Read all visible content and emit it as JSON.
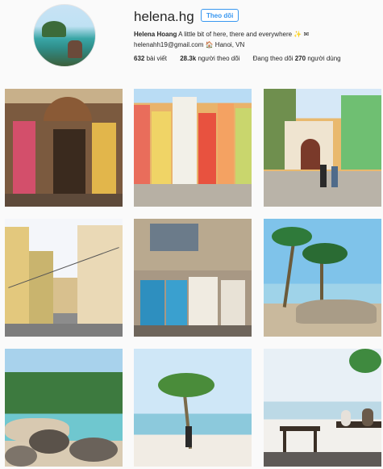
{
  "profile": {
    "username": "helena.hg",
    "follow_label": "Theo dõi",
    "full_name": "Helena Hoang",
    "bio": "A little bit of here, there and everywhere ✨ ✉",
    "contact": "helenahh19@gmail.com 🏠 Hanoi, VN",
    "stats": {
      "posts_count": "632",
      "posts_label": "bài viết",
      "followers_count": "28.3k",
      "followers_label": "người theo dõi",
      "following_prefix": "Đang theo dõi",
      "following_count": "270",
      "following_label": "người dùng"
    }
  },
  "posts": [
    {
      "subject": "colorful souvenir shop"
    },
    {
      "subject": "colorful cliffside houses"
    },
    {
      "subject": "church and street with people"
    },
    {
      "subject": "city street with tram wires"
    },
    {
      "subject": "storefront with blue doors"
    },
    {
      "subject": "palm trees at beach"
    },
    {
      "subject": "tropical beach with rocks"
    },
    {
      "subject": "palm tree and person on sand"
    },
    {
      "subject": "dining tables on beach"
    }
  ]
}
